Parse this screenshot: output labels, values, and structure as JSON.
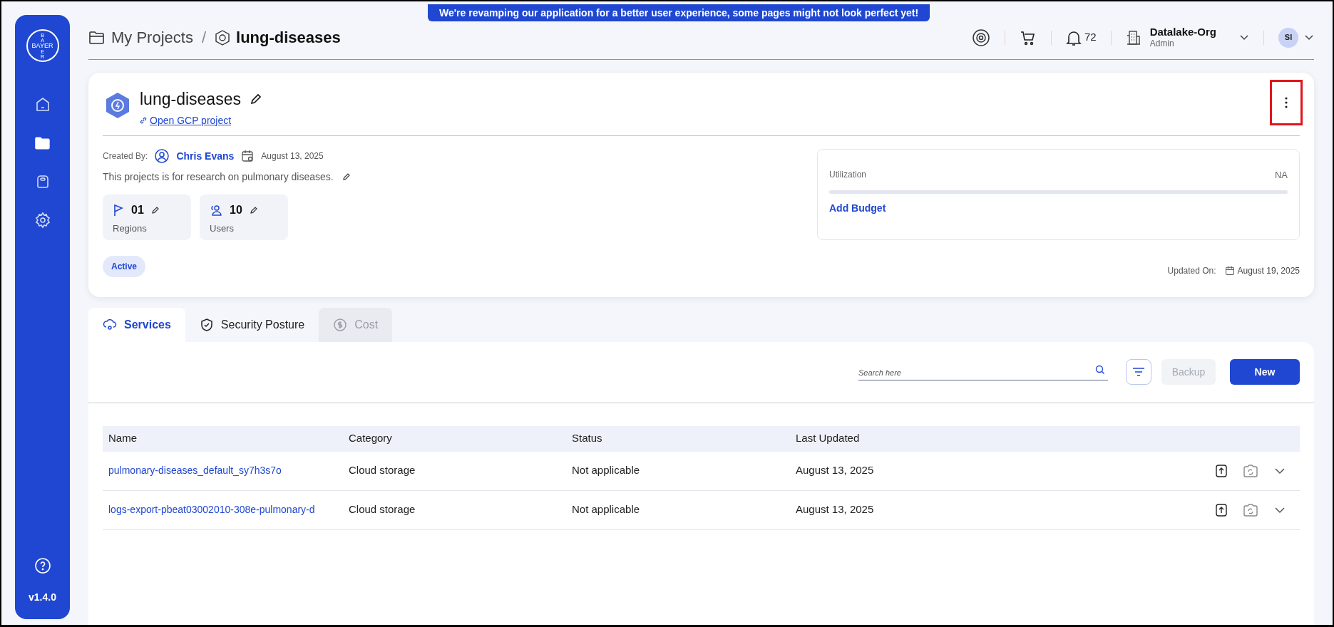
{
  "logo": {
    "top": "BA",
    "middle": "BAYER",
    "bottom": "ER"
  },
  "banner": "We're revamping our application for a better user experience, some pages might not look perfect yet!",
  "sidebar": {
    "items": [
      {
        "kind": "home",
        "selected": false
      },
      {
        "kind": "projects",
        "selected": true
      },
      {
        "kind": "bag",
        "selected": false
      },
      {
        "kind": "settings",
        "selected": false
      }
    ],
    "version": "v1.4.0"
  },
  "breadcrumb": [
    "My Projects",
    "/",
    "lung-diseases"
  ],
  "header": {
    "notifications": "72",
    "org": "Datalake-Org",
    "role": "Admin",
    "avatar": "SI"
  },
  "project": {
    "title": "lung-diseases",
    "link": "Open GCP project",
    "menu_highlighted": true,
    "created_by_label": "Created By:",
    "creator": "Chris Evans",
    "created_date": "August 13, 2025",
    "description": "This projects is for research on pulmonary diseases.",
    "stats": [
      {
        "kind": "regions",
        "value": "01",
        "label": "Regions"
      },
      {
        "kind": "users",
        "value": "10",
        "label": "Users"
      }
    ],
    "status": "Active",
    "utilization_label": "Utilization",
    "utilization_value": "NA",
    "add_budget": "Add Budget",
    "updated_label": "Updated On:",
    "updated_date": "August 19, 2025"
  },
  "tabs": [
    {
      "kind": "services",
      "label": "Services",
      "selected": true,
      "disabled": false
    },
    {
      "kind": "security",
      "label": "Security Posture",
      "selected": false,
      "disabled": false
    },
    {
      "kind": "cost",
      "label": "Cost",
      "selected": false,
      "disabled": true
    }
  ],
  "toolbar": {
    "search_placeholder": "Search here",
    "backup": "Backup",
    "backup_disabled": true,
    "new": "New"
  },
  "table": {
    "columns": [
      "Name",
      "Category",
      "Status",
      "Last Updated"
    ],
    "rows": [
      [
        "pulmonary-diseases_default_sy7h3s7o",
        "Cloud storage",
        "Not applicable",
        "August 13, 2025"
      ],
      [
        "logs-export-pbeat03002010-308e-pulmonary-d",
        "Cloud storage",
        "Not applicable",
        "August 13, 2025"
      ]
    ]
  }
}
